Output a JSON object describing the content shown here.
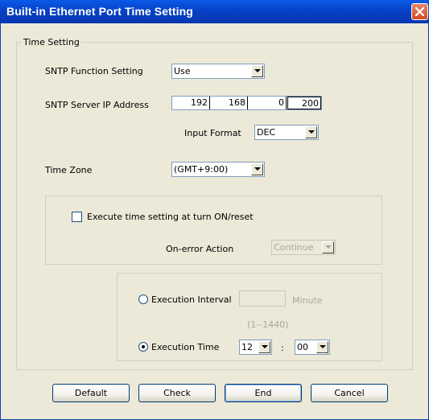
{
  "window": {
    "title": "Built-in Ethernet Port Time Setting"
  },
  "time_setting_group": {
    "legend": "Time Setting"
  },
  "sntp_function": {
    "label": "SNTP Function Setting",
    "value": "Use"
  },
  "sntp_server": {
    "label": "SNTP Server IP Address",
    "octets": [
      "192",
      "168",
      "0",
      "200"
    ]
  },
  "input_format": {
    "label": "Input Format",
    "value": "DEC"
  },
  "time_zone": {
    "label": "Time Zone",
    "value": "(GMT+9:00)"
  },
  "execute_on_reset": {
    "label": "Execute time setting at turn ON/reset",
    "checked": false
  },
  "on_error": {
    "label": "On-error Action",
    "value": "Continue"
  },
  "execution_interval": {
    "label": "Execution Interval",
    "value": "",
    "unit": "Minute",
    "range": "(1--1440)",
    "selected": false
  },
  "execution_time": {
    "label": "Execution Time",
    "hour": "12",
    "separator": ":",
    "minute": "00",
    "selected": true
  },
  "buttons": {
    "default": "Default",
    "check": "Check",
    "end": "End",
    "cancel": "Cancel"
  },
  "colors": {
    "titlebar": "#0842C8",
    "dialog_bg": "#ECE9D8",
    "close_button": "#D24B23",
    "disabled_text": "#A7A69B"
  }
}
